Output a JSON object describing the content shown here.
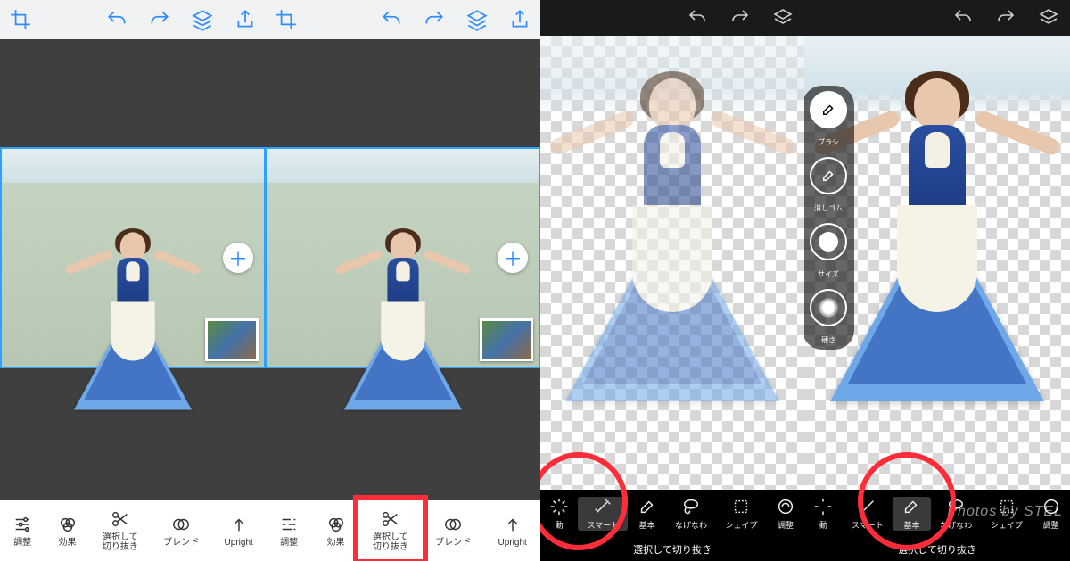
{
  "light_toolbar_icons": [
    "crop",
    "undo",
    "redo",
    "layers",
    "share"
  ],
  "dark_toolbar_icons": [
    "undo",
    "redo",
    "layers"
  ],
  "bottom_light": {
    "items": [
      {
        "label": "調整"
      },
      {
        "label": "効果"
      },
      {
        "label": "選択して\n切り抜き"
      },
      {
        "label": "ブレンド"
      },
      {
        "label": "Upright"
      }
    ],
    "highlight_index": 2
  },
  "bottom_dark": {
    "items": [
      {
        "label": "動"
      },
      {
        "label": "スマート"
      },
      {
        "label": "基本"
      },
      {
        "label": "なげなわ"
      },
      {
        "label": "シェイプ"
      },
      {
        "label": "調整"
      }
    ],
    "title": "選択して切り抜き",
    "active_panel3_index": 1,
    "active_panel4_index": 2
  },
  "side_palette": [
    {
      "label": "ブラシ"
    },
    {
      "label": "消しゴム"
    },
    {
      "label": "サイズ"
    },
    {
      "label": "硬さ"
    }
  ],
  "watermark": "Photos by STEL",
  "plus_glyph": "＋"
}
